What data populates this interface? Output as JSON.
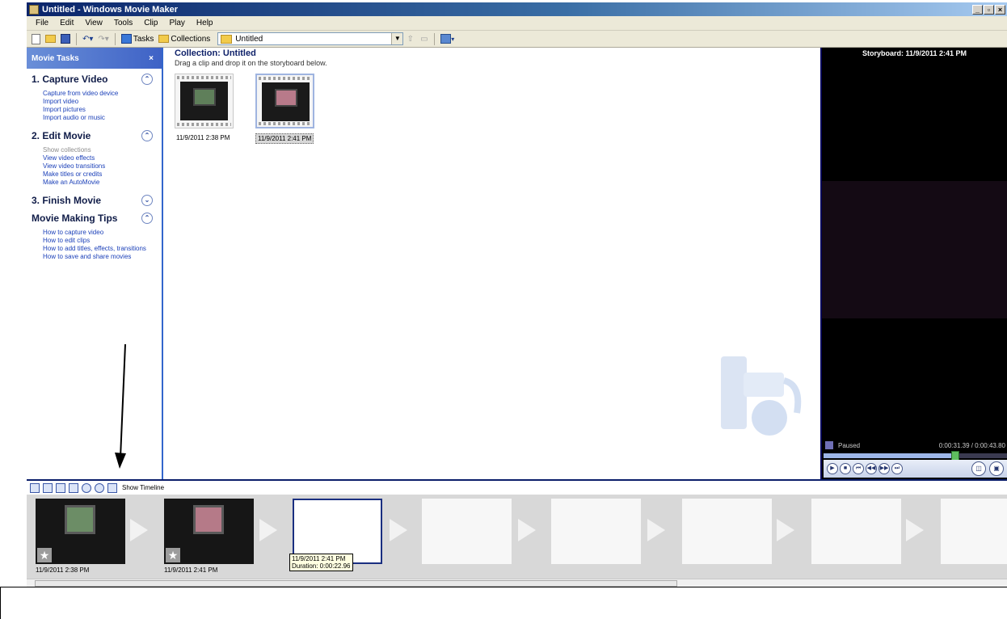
{
  "window": {
    "title": "Untitled - Windows Movie Maker",
    "buttons": [
      "_",
      "▫",
      "×"
    ]
  },
  "menu": [
    "File",
    "Edit",
    "View",
    "Tools",
    "Clip",
    "Play",
    "Help"
  ],
  "toolbar": {
    "tasks_label": "Tasks",
    "collections_label": "Collections",
    "collection_value": "Untitled"
  },
  "tasks": {
    "header": "Movie Tasks",
    "close": "×",
    "sections": [
      {
        "title": "1. Capture Video",
        "chev": "⌃",
        "links": [
          "Capture from video device",
          "Import video",
          "Import pictures",
          "Import audio or music"
        ]
      },
      {
        "title": "2. Edit Movie",
        "chev": "⌃",
        "links": [
          "Show collections",
          "View video effects",
          "View video transitions",
          "Make titles or credits",
          "Make an AutoMovie"
        ]
      },
      {
        "title": "3. Finish Movie",
        "chev": "⌄",
        "links": []
      },
      {
        "title": "Movie Making Tips",
        "chev": "⌃",
        "links": [
          "How to capture video",
          "How to edit clips",
          "How to add titles, effects, transitions",
          "How to save and share movies"
        ]
      }
    ]
  },
  "collection": {
    "title": "Collection: Untitled",
    "subtitle": "Drag a clip and drop it on the storyboard below.",
    "clips": [
      {
        "caption": "11/9/2011 2:38 PM"
      },
      {
        "caption": "11/9/2011 2:41 PM"
      }
    ]
  },
  "monitor": {
    "title": "Storyboard: 11/9/2011 2:41 PM",
    "status": "Paused",
    "time": "0:00:31.39 / 0:00:43.80",
    "progress": 0.72
  },
  "storyboard": {
    "show_timeline": "Show Timeline",
    "captions": [
      "11/9/2011 2:38 PM",
      "11/9/2011 2:41 PM"
    ],
    "tooltip_line1": "11/9/2011 2:41 PM",
    "tooltip_line2": "Duration: 0:00:22.96"
  }
}
